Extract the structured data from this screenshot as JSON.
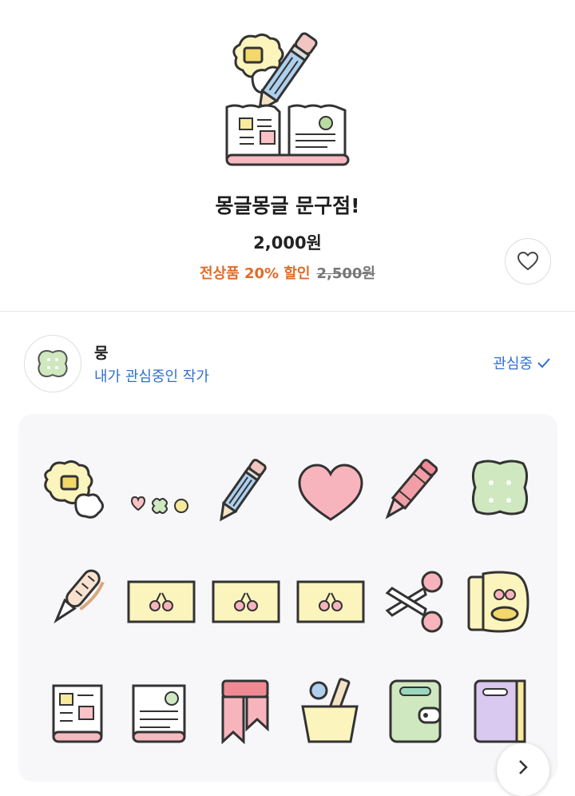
{
  "product": {
    "title": "몽글몽글 문구점!",
    "price": "2,000원",
    "discount_text": "전상품 20% 할인",
    "original_price": "2,500원"
  },
  "artist": {
    "name": "뭉",
    "subtitle": "내가 관심중인 작가",
    "follow_label": "관심중"
  },
  "icons": {
    "like": "heart-outline-icon",
    "follow": "check-icon",
    "next": "chevron-right-icon"
  },
  "colors": {
    "discount": "#e06b2b",
    "link": "#2f6fd1"
  },
  "emoticons": [
    "eraser",
    "dots-heart-clover",
    "blue-pencil",
    "pink-heart",
    "pink-crayon",
    "green-clover-note",
    "fountain-pen",
    "cherry-tape",
    "cherry-tape",
    "cherry-tape",
    "scissors",
    "cherry-tape-roll",
    "notebook-left",
    "notebook-right",
    "pink-bookmark",
    "pencil-cup",
    "green-wallet",
    "purple-diary"
  ]
}
